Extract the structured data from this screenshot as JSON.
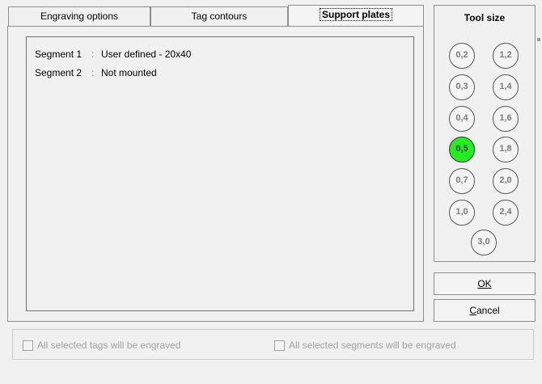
{
  "tabs": [
    {
      "label": "Engraving options"
    },
    {
      "label": "Tag contours"
    },
    {
      "label": "Support plates"
    }
  ],
  "segments": [
    {
      "label": "Segment 1",
      "separator": ":",
      "value": "User defined - 20x40"
    },
    {
      "label": "Segment 2",
      "separator": ":",
      "value": "Not mounted"
    }
  ],
  "tool_size": {
    "title": "Tool size",
    "selected": "0,5",
    "sizes": [
      "0,2",
      "1,2",
      "0,3",
      "1,4",
      "0,4",
      "1,6",
      "0,5",
      "1,8",
      "0,7",
      "2,0",
      "1,0",
      "2,4",
      "3,0"
    ]
  },
  "buttons": {
    "ok_label": "OK",
    "cancel_label": "Cancel"
  },
  "options": {
    "tags_checkbox": {
      "label": "All selected tags will be engraved",
      "checked": false
    },
    "segments_checkbox": {
      "label": "All selected segments will be engraved",
      "checked": false
    }
  }
}
